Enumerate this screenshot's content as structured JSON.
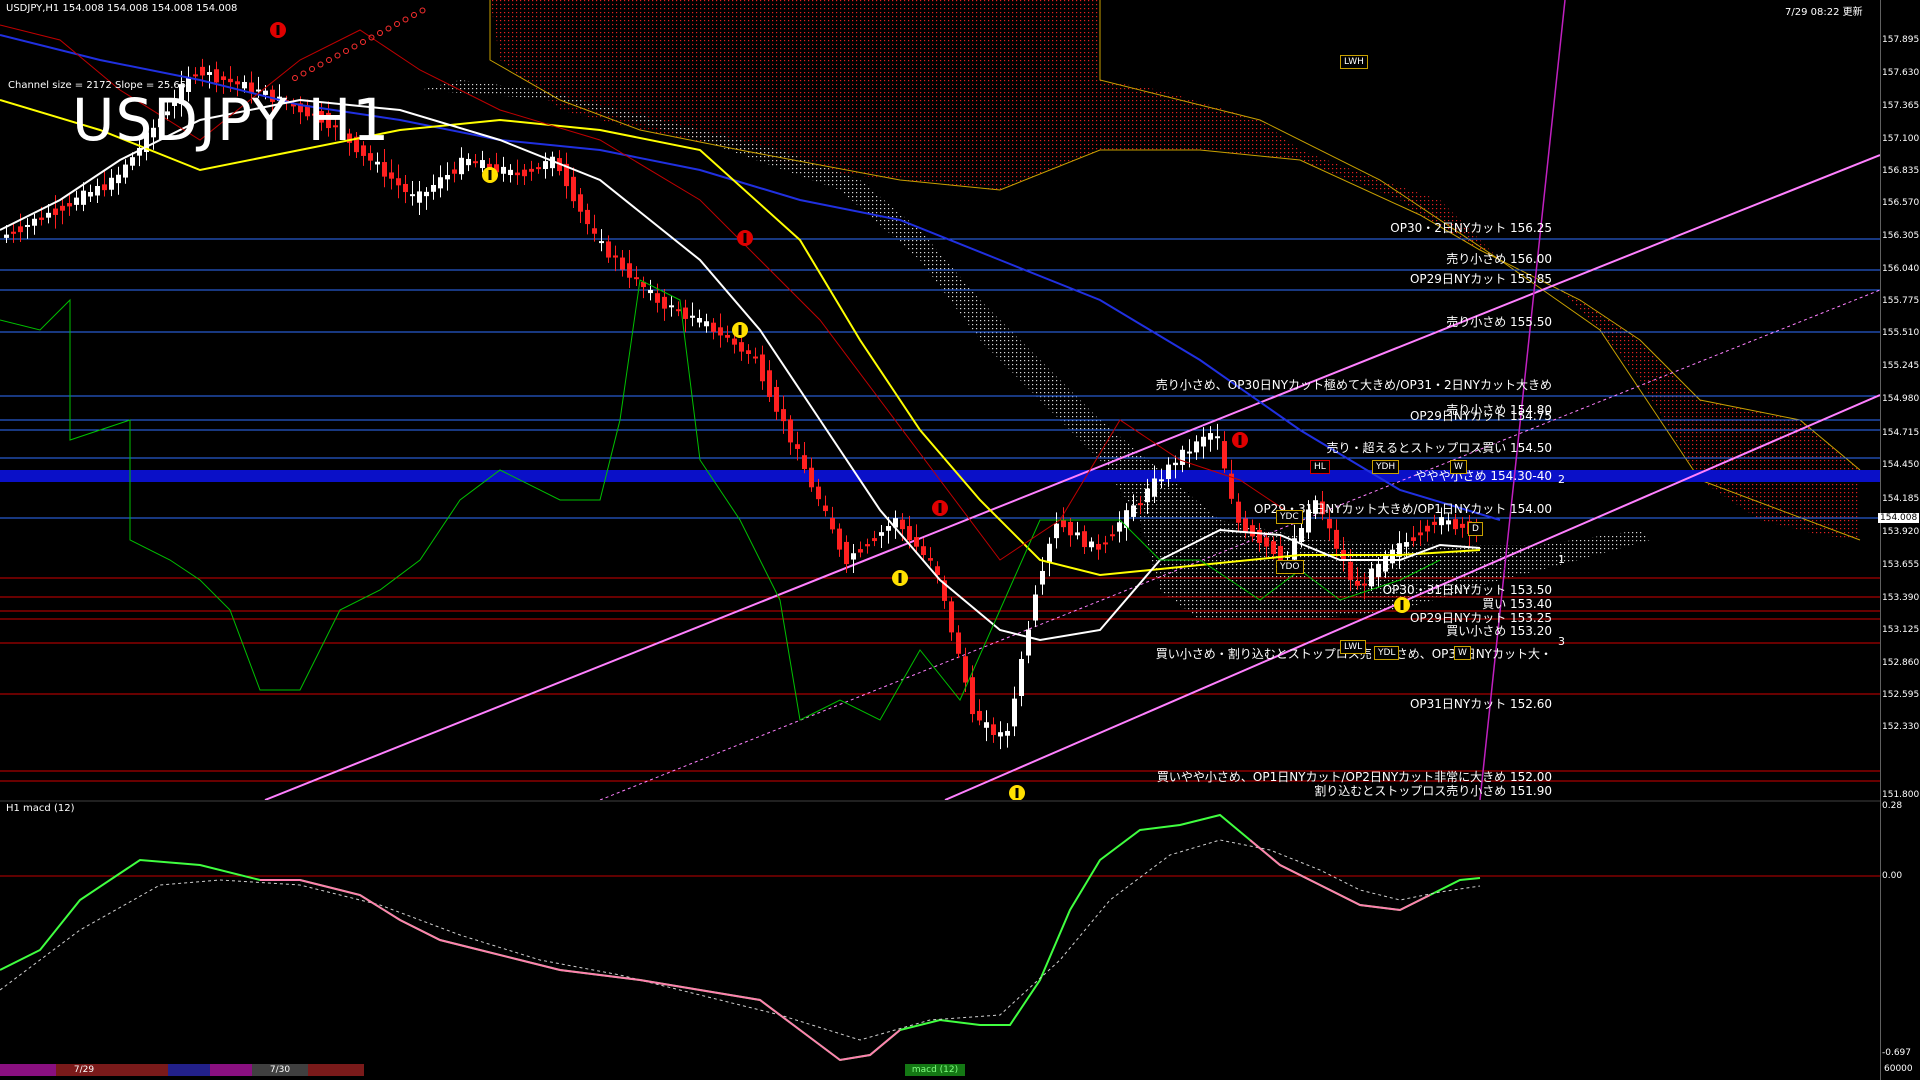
{
  "header": {
    "symbol_info": "USDJPY,H1  154.008 154.008 154.008 154.008",
    "datetime": "7/29 08:22 更新"
  },
  "chart_title": "USDJPY H1",
  "channel_info": "Channel size = 2172  Slope = 25.65",
  "current_price": "154.008",
  "price_axis": [
    "157.895",
    "157.630",
    "157.365",
    "157.100",
    "156.835",
    "156.570",
    "156.305",
    "156.040",
    "155.775",
    "155.510",
    "155.245",
    "154.980",
    "154.715",
    "154.450",
    "154.185",
    "153.920",
    "153.655",
    "153.390",
    "153.125",
    "152.860",
    "152.595",
    "152.330",
    "151.800"
  ],
  "level_labels": [
    {
      "text": "OP30・2日NYカット 156.25"
    },
    {
      "text": "売り小さめ 156.00"
    },
    {
      "text": "OP29日NYカット 155.85"
    },
    {
      "text": "売り小さめ 155.50"
    },
    {
      "text": "売り小さめ、OP30日NYカット極めて大きめ/OP31・2日NYカット大きめ"
    },
    {
      "text": "売り小さめ 154.80"
    },
    {
      "text": "OP29日NYカット 154.75"
    },
    {
      "text": "売り・超えるとストップロス買い 154.50"
    },
    {
      "text": "ややや小さめ 154.30-40"
    },
    {
      "text": "OP29・31日NYカット大きめ/OP1日NYカット 154.00"
    },
    {
      "text": "OP30・31日NYカット 153.50"
    },
    {
      "text": "買い 153.40"
    },
    {
      "text": "OP29日NYカット 153.25"
    },
    {
      "text": "買い小さめ 153.20"
    },
    {
      "text": "買い小さめ・割り込むとストップロス売り小さめ、OP30日NYカット大・"
    },
    {
      "text": "OP31日NYカット 152.60"
    },
    {
      "text": "買いやや小さめ、OP1日NYカット/OP2日NYカット非常に大きめ 152.00"
    },
    {
      "text": "割り込むとストップロス売り小さめ 151.90"
    }
  ],
  "boxes": {
    "lwh": "LWH",
    "ydh": "YDH",
    "hl": "HL",
    "w1": "W",
    "ydc": "YDC",
    "ydo": "YDO",
    "d": "D",
    "lwl": "LWL",
    "ydl": "YDL",
    "w2": "W"
  },
  "channel_markers": {
    "m1": "1",
    "m2": "2",
    "m3": "3"
  },
  "macd": {
    "title": "H1  macd (12)",
    "axis_top": "0.28",
    "axis_zero": "0.00",
    "axis_bottom": "-0.697",
    "tag": "macd (12)"
  },
  "timebar": {
    "d1": "7/29",
    "d2": "7/30",
    "right_label": "60000"
  },
  "colors": {
    "background": "#000000",
    "pink_channel": "#ff80ff",
    "blue_level": "#3070ff",
    "red_level": "#d00000",
    "ichimoku_red": "#c00000",
    "yellow": "#ffff00",
    "green": "#00c000",
    "macd_green": "#40ff40",
    "macd_pink": "#ff80b0"
  }
}
